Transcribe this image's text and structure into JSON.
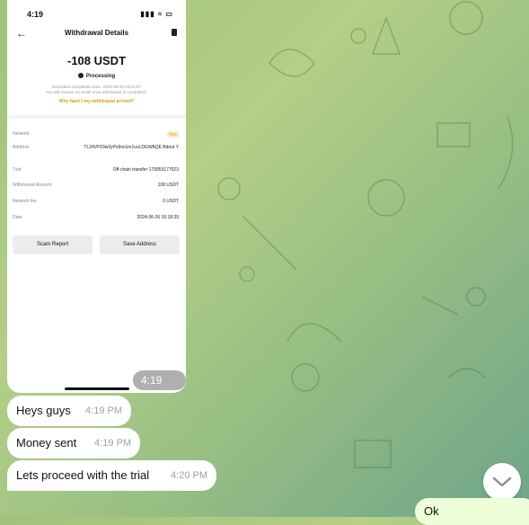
{
  "screenshot": {
    "status_time": "4:19",
    "status_icons": "▮▮▮ ≈ ▭",
    "header_title": "Withdrawal Details",
    "amount": "-108 USDT",
    "status": "Processing",
    "estimate_line": "Estimated completion time: 2024-06-26 16:21:07",
    "email_line": "You will receive an email once withdrawal is completed.",
    "why_link": "Why hasn't my withdrawal arrived?",
    "rows": [
      {
        "label": "Network",
        "value": "TRX"
      },
      {
        "label": "Address",
        "value": "TL24VF93w3yPs9sn1m1vuLDGWAQE Bdnut Y"
      },
      {
        "label": "Txid",
        "value": "Off-chain transfer 179953177523"
      },
      {
        "label": "Withdrawal Amount",
        "value": "108 USDT"
      },
      {
        "label": "Network fee",
        "value": "0 USDT"
      },
      {
        "label": "Date",
        "value": "2024-06-26 16:18:39"
      }
    ],
    "scam_button": "Scam Report",
    "save_button": "Save Address"
  },
  "messages": [
    {
      "text": "4:19 PM"
    },
    {
      "text": "Heys guys",
      "time": "4:19 PM"
    },
    {
      "text": "Money sent",
      "time": "4:19 PM"
    },
    {
      "text": "Lets proceed with the trial",
      "time": "4:20 PM"
    }
  ],
  "outgoing": {
    "text": "Ok"
  },
  "colors": {
    "accent": "#d9a20b",
    "incoming": "#ffffff",
    "outgoing": "#eefed9"
  }
}
